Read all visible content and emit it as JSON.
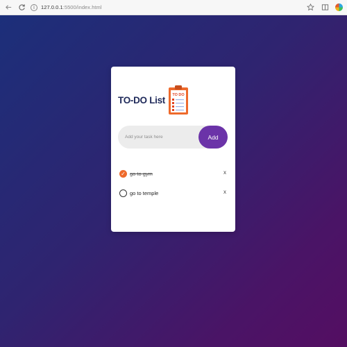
{
  "browser": {
    "url_host": "127.0.0.1",
    "url_path": ":5500/index.html",
    "info_glyph": "i"
  },
  "card": {
    "title": "TO-DO List",
    "clipboard_label": "TO DO"
  },
  "input": {
    "placeholder": "Add your task here",
    "value": ""
  },
  "add_button": {
    "label": "Add"
  },
  "tasks": [
    {
      "text": "go to gym",
      "completed": true,
      "check_glyph": "✓",
      "delete_label": "x"
    },
    {
      "text": "go to temple",
      "completed": false,
      "check_glyph": "",
      "delete_label": "x"
    }
  ],
  "colors": {
    "accent": "#6b33a8",
    "check": "#ee6a2c",
    "title": "#1f2a5a",
    "gradient_start": "#1c2f7a",
    "gradient_end": "#540e62"
  },
  "icons": [
    "back-arrow-icon",
    "reload-icon",
    "info-icon",
    "star-icon",
    "split-screen-icon",
    "extension-icon",
    "clipboard-icon"
  ]
}
